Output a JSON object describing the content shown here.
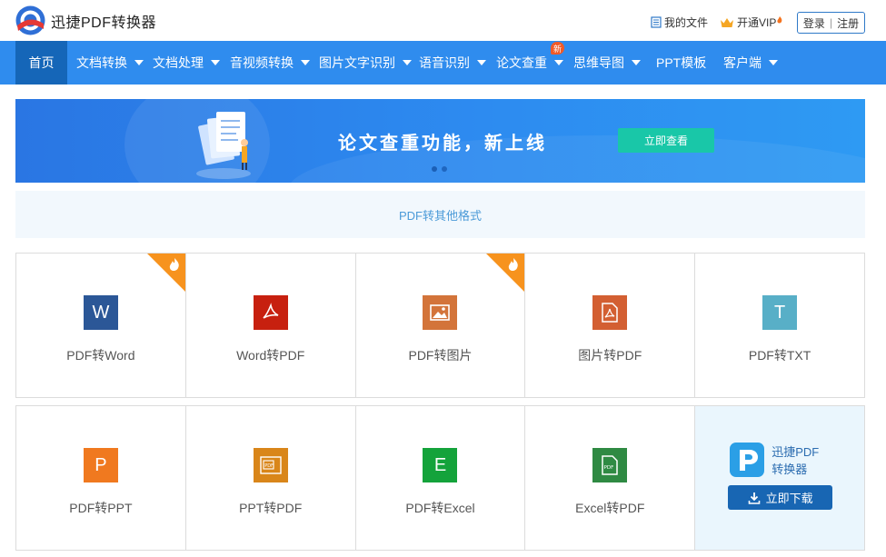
{
  "header": {
    "app_title": "迅捷PDF转换器",
    "my_files": "我的文件",
    "vip": "开通VIP",
    "login": "登录",
    "separator": "|",
    "register": "注册"
  },
  "nav": {
    "items": [
      {
        "label": "首页"
      },
      {
        "label": "文档转换"
      },
      {
        "label": "文档处理"
      },
      {
        "label": "音视频转换"
      },
      {
        "label": "图片文字识别"
      },
      {
        "label": "语音识别"
      },
      {
        "label": "论文查重"
      },
      {
        "label": "思维导图"
      },
      {
        "label": "PPT模板"
      },
      {
        "label": "客户端"
      }
    ],
    "new_badge": "新"
  },
  "banner": {
    "headline": "论文查重功能，新上线",
    "button": "立即查看"
  },
  "section": {
    "title": "PDF转其他格式"
  },
  "tools": {
    "row1": [
      {
        "label": "PDF转Word",
        "glyph": "W",
        "color": "#2b5797",
        "hot": true
      },
      {
        "label": "Word转PDF",
        "glyph": "pdf",
        "color": "#c7200f",
        "hot": false
      },
      {
        "label": "PDF转图片",
        "glyph": "img",
        "color": "#d3743a",
        "hot": true
      },
      {
        "label": "图片转PDF",
        "glyph": "pdf",
        "color": "#d35f32",
        "hot": false
      },
      {
        "label": "PDF转TXT",
        "glyph": "T",
        "color": "#58afc7",
        "hot": false
      }
    ],
    "row2": [
      {
        "label": "PDF转PPT",
        "glyph": "P",
        "color": "#f0791f",
        "hot": false
      },
      {
        "label": "PPT转PDF",
        "glyph": "PDF",
        "color": "#d9861a",
        "hot": false
      },
      {
        "label": "PDF转Excel",
        "glyph": "E",
        "color": "#14a33b",
        "hot": false
      },
      {
        "label": "Excel转PDF",
        "glyph": "PDF",
        "color": "#2f8a43",
        "hot": false
      }
    ]
  },
  "download": {
    "name_line1": "迅捷PDF",
    "name_line2": "转换器",
    "button": "立即下载"
  },
  "colors": {
    "nav_bg": "#2f8cee",
    "nav_active": "#1566b8",
    "banner_button": "#19c7a8",
    "hot_corner": "#f7931e",
    "download_button": "#1866b3"
  }
}
